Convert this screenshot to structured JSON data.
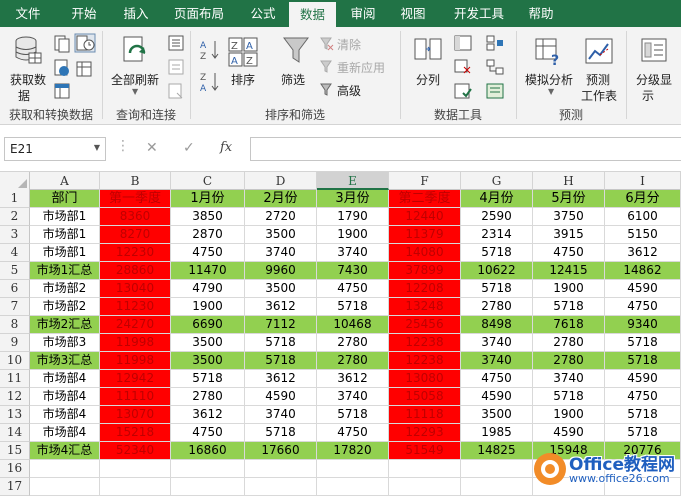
{
  "tabs": [
    "文件",
    "开始",
    "插入",
    "页面布局",
    "公式",
    "数据",
    "审阅",
    "视图",
    "开发工具",
    "帮助"
  ],
  "active_tab": "数据",
  "ribbon": {
    "get_data": "获取数",
    "get_data2": "据",
    "refresh_all": "全部刷新",
    "sort": "排序",
    "filter": "筛选",
    "clear": "清除",
    "reapply": "重新应用",
    "advanced": "高级",
    "split": "分列",
    "whatif": "模拟分析",
    "forecast": "预测",
    "forecast_sheet": "工作表",
    "outline": "分级显",
    "outline2": "示",
    "groups": [
      "获取和转换数据",
      "查询和连接",
      "排序和筛选",
      "数据工具",
      "预测"
    ]
  },
  "formula_bar": {
    "name_box": "E21",
    "fx": "fx",
    "formula": ""
  },
  "columns": [
    "A",
    "B",
    "C",
    "D",
    "E",
    "F",
    "G",
    "H",
    "I"
  ],
  "selected_column": "E",
  "rows": [
    "1",
    "2",
    "3",
    "4",
    "5",
    "6",
    "7",
    "8",
    "9",
    "10",
    "11",
    "12",
    "13",
    "14",
    "15",
    "16",
    "17"
  ],
  "table": [
    [
      "部门",
      "第一季度",
      "1月份",
      "2月份",
      "3月份",
      "第二季度",
      "4月份",
      "5月份",
      "6月分"
    ],
    [
      "市场部1",
      "8360",
      "3850",
      "2720",
      "1790",
      "12440",
      "2590",
      "3750",
      "6100"
    ],
    [
      "市场部1",
      "8270",
      "2870",
      "3500",
      "1900",
      "11379",
      "2314",
      "3915",
      "5150"
    ],
    [
      "市场部1",
      "12230",
      "4750",
      "3740",
      "3740",
      "14080",
      "5718",
      "4750",
      "3612"
    ],
    [
      "市场1汇总",
      "28860",
      "11470",
      "9960",
      "7430",
      "37899",
      "10622",
      "12415",
      "14862"
    ],
    [
      "市场部2",
      "13040",
      "4790",
      "3500",
      "4750",
      "12208",
      "5718",
      "1900",
      "4590"
    ],
    [
      "市场部2",
      "11230",
      "1900",
      "3612",
      "5718",
      "13248",
      "2780",
      "5718",
      "4750"
    ],
    [
      "市场2汇总",
      "24270",
      "6690",
      "7112",
      "10468",
      "25456",
      "8498",
      "7618",
      "9340"
    ],
    [
      "市场部3",
      "11998",
      "3500",
      "5718",
      "2780",
      "12238",
      "3740",
      "2780",
      "5718"
    ],
    [
      "市场3汇总",
      "11998",
      "3500",
      "5718",
      "2780",
      "12238",
      "3740",
      "2780",
      "5718"
    ],
    [
      "市场部4",
      "12942",
      "5718",
      "3612",
      "3612",
      "13080",
      "4750",
      "3740",
      "4590"
    ],
    [
      "市场部4",
      "11110",
      "2780",
      "4590",
      "3740",
      "15058",
      "4590",
      "5718",
      "4750"
    ],
    [
      "市场部4",
      "13070",
      "3612",
      "3740",
      "5718",
      "11118",
      "3500",
      "1900",
      "5718"
    ],
    [
      "市场部4",
      "15218",
      "4750",
      "5718",
      "4750",
      "12293",
      "1985",
      "4590",
      "5718"
    ],
    [
      "市场4汇总",
      "52340",
      "16860",
      "17660",
      "17820",
      "51549",
      "14825",
      "15948",
      "20776"
    ]
  ],
  "summary_rows": [
    5,
    8,
    10,
    15
  ],
  "watermark": {
    "line1": "Office教程网",
    "line2": "www.office26.com"
  },
  "colors": {
    "excel_green": "#217346",
    "summary_fill": "#92d050",
    "quarter_fill": "#ff0000",
    "quarter_text": "#c00000"
  }
}
